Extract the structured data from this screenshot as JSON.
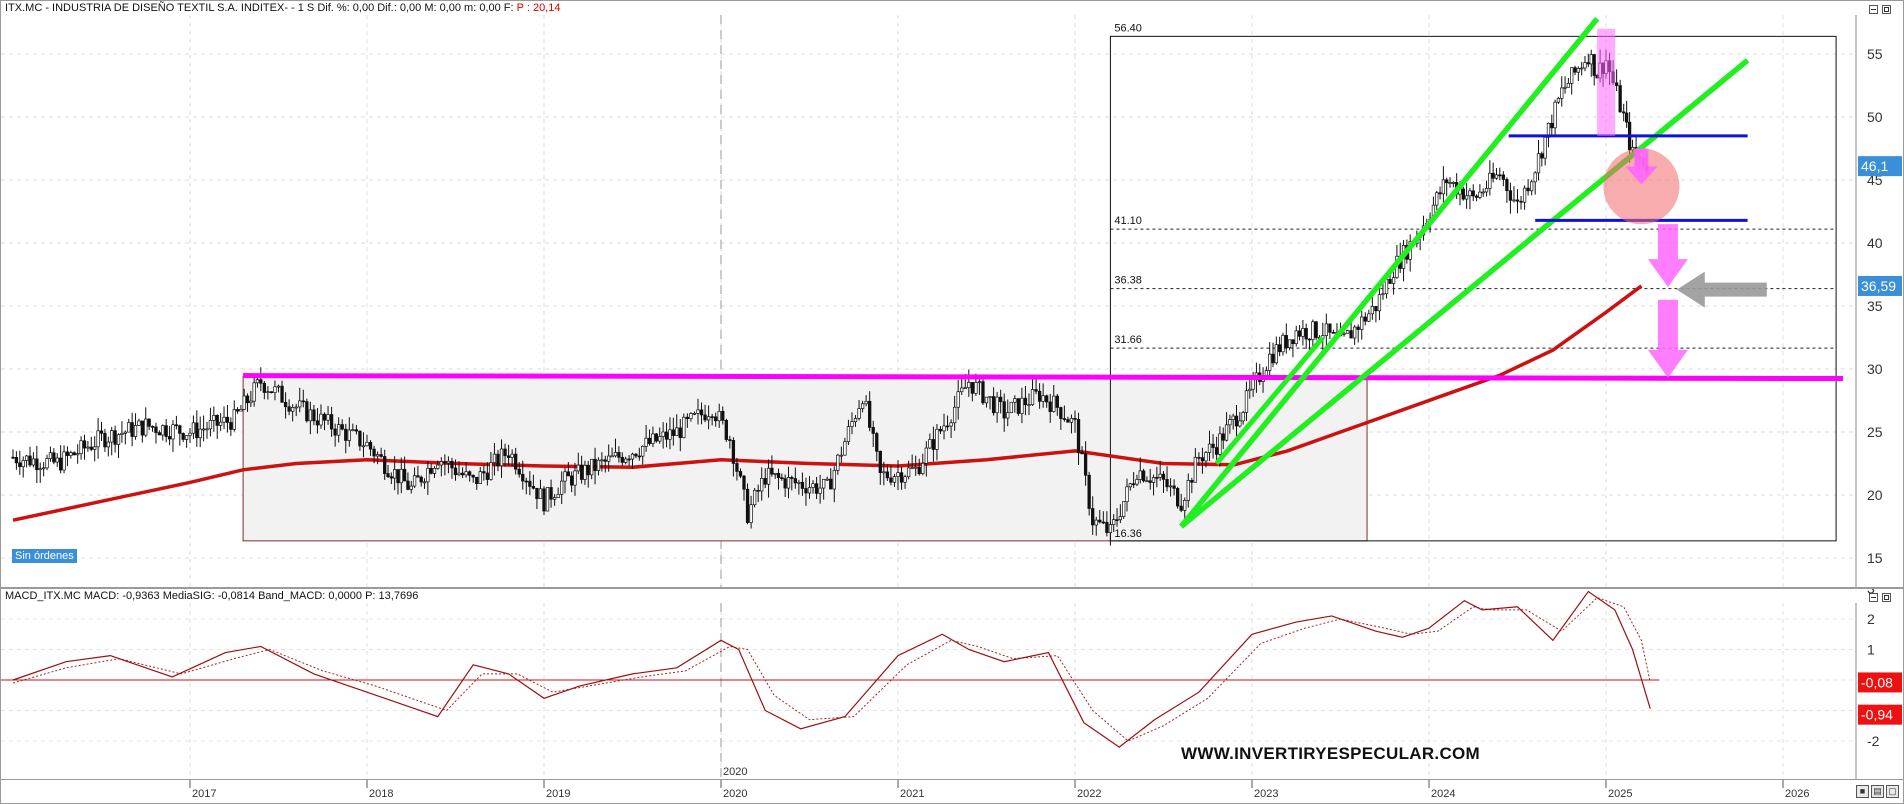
{
  "price_pane": {
    "header": {
      "main": "ITX.MC - INDUSTRIA DE DISEÑO TEXTIL S.A. INDITEX-  -  1 S  Dif. %: 0,00  Dif.: 0,00  M: 0,00  m: 0,00  F:",
      "value": "P : 20,14"
    },
    "badge": "Sin órdenes",
    "y_axis_ticks": [
      "15",
      "20",
      "25",
      "30",
      "35",
      "40",
      "45",
      "50",
      "55"
    ],
    "fib_labels": [
      "56.40",
      "41.10",
      "36.38",
      "31.66",
      "16.36"
    ],
    "price_tag_last": "46,1",
    "price_tag_ma": "36,59"
  },
  "macd_pane": {
    "header": "MACD_ITX.MC  MACD: -0,9363  MediaSIG: -0,0814  Band_MACD: 0,0000  P: 13,7696",
    "y_axis_ticks": [
      "3",
      "2",
      "1",
      "0",
      "-1",
      "-2"
    ],
    "tag_signal": "-0,08",
    "tag_macd": "-0,94",
    "watermark": "WWW.INVERTIRYESPECULAR.COM"
  },
  "x_axis": {
    "year_labels": [
      "2017",
      "2018",
      "2019",
      "2020",
      "2021",
      "2022",
      "2023",
      "2024",
      "2025",
      "2026"
    ],
    "cursor_label": "2020"
  },
  "colors": {
    "candles": "#111111",
    "ma": "#cc1111",
    "resistance": "#ff00ff",
    "channel": "#22ee22",
    "support_lines": "#1111dd",
    "arrows": "#ff66ff",
    "gray_arrow": "#999999",
    "tag_blue": "#3b8fd9",
    "tag_red": "#ee1111"
  },
  "chart_data": [
    {
      "type": "line",
      "title": "ITX.MC - INDUSTRIA DE DISEÑO TEXTIL S.A. INDITEX",
      "x_unit": "year",
      "xlim": [
        2016.0,
        2026.6
      ],
      "ylim": [
        14,
        58
      ],
      "series": [
        {
          "style": "candlestick-weekly",
          "x": [
            2016.0,
            2016.25,
            2016.5,
            2016.75,
            2017.0,
            2017.25,
            2017.4,
            2017.6,
            2017.8,
            2018.0,
            2018.1,
            2018.25,
            2018.4,
            2018.6,
            2018.8,
            2019.0,
            2019.1,
            2019.25,
            2019.5,
            2019.75,
            2019.95,
            2020.05,
            2020.15,
            2020.25,
            2020.4,
            2020.6,
            2020.8,
            2020.9,
            2021.1,
            2021.3,
            2021.4,
            2021.6,
            2021.8,
            2021.9,
            2022.0,
            2022.1,
            2022.2,
            2022.35,
            2022.5,
            2022.6,
            2022.7,
            2022.8,
            2022.95,
            2023.1,
            2023.25,
            2023.4,
            2023.5,
            2023.7,
            2023.8,
            2023.95,
            2024.1,
            2024.25,
            2024.4,
            2024.5,
            2024.6,
            2024.75,
            2024.9,
            2024.95,
            2025.0,
            2025.1,
            2025.15,
            2025.25
          ],
          "y": [
            23,
            22.5,
            24.5,
            25.5,
            25,
            26,
            29,
            27,
            25.5,
            24,
            22.5,
            20.5,
            23,
            21,
            23.5,
            19.5,
            21,
            22,
            23.5,
            25,
            27,
            24.5,
            18.5,
            21.5,
            21,
            20.5,
            28,
            21.5,
            22,
            26.5,
            29,
            26.5,
            28,
            27,
            25.5,
            18,
            17,
            22,
            21,
            19.5,
            23,
            24,
            27,
            31,
            33,
            33,
            32,
            35,
            38,
            41,
            45,
            43.5,
            45.5,
            43,
            46,
            52,
            55,
            53.5,
            54.5,
            50,
            47,
            46.1
          ]
        },
        {
          "style": "moving-average",
          "x": [
            2016.0,
            2016.5,
            2017.0,
            2017.3,
            2017.6,
            2018.0,
            2018.5,
            2019.0,
            2019.5,
            2020.0,
            2020.5,
            2021.0,
            2021.5,
            2022.0,
            2022.5,
            2022.9,
            2023.2,
            2023.5,
            2023.8,
            2024.1,
            2024.4,
            2024.7,
            2025.0,
            2025.2
          ],
          "y": [
            18,
            19.5,
            21,
            22,
            22.5,
            22.8,
            22.5,
            22.3,
            22.2,
            22.8,
            22.5,
            22.3,
            22.8,
            23.5,
            22.5,
            22.4,
            23.5,
            25,
            26.5,
            28,
            29.5,
            31.5,
            34.5,
            36.59
          ]
        }
      ],
      "annotations": {
        "horizontal_resistance": 29.4,
        "fib_levels": [
          56.4,
          41.1,
          36.38,
          31.66,
          16.36
        ],
        "support_lines": [
          48.5,
          41.8
        ]
      }
    },
    {
      "type": "line",
      "title": "MACD_ITX.MC",
      "x_unit": "year",
      "xlim": [
        2016.0,
        2026.6
      ],
      "ylim": [
        -2.6,
        3.2
      ],
      "series": [
        {
          "style": "macd",
          "x": [
            2016.0,
            2016.3,
            2016.55,
            2016.9,
            2017.2,
            2017.4,
            2017.7,
            2018.0,
            2018.25,
            2018.4,
            2018.6,
            2018.8,
            2019.0,
            2019.2,
            2019.5,
            2019.75,
            2020.0,
            2020.1,
            2020.25,
            2020.45,
            2020.7,
            2021.0,
            2021.25,
            2021.4,
            2021.6,
            2021.85,
            2022.05,
            2022.25,
            2022.45,
            2022.7,
            2023.0,
            2023.25,
            2023.45,
            2023.7,
            2023.85,
            2024.0,
            2024.2,
            2024.3,
            2024.5,
            2024.7,
            2024.9,
            2025.05,
            2025.15,
            2025.25
          ],
          "y": [
            0.0,
            0.6,
            0.8,
            0.1,
            0.9,
            1.1,
            0.2,
            -0.4,
            -0.9,
            -1.2,
            0.5,
            0.2,
            -0.6,
            -0.2,
            0.2,
            0.4,
            1.3,
            1.0,
            -1.0,
            -1.6,
            -1.2,
            0.8,
            1.5,
            1.0,
            0.6,
            0.9,
            -1.4,
            -2.2,
            -1.3,
            -0.4,
            1.5,
            1.9,
            2.1,
            1.6,
            1.4,
            1.7,
            2.6,
            2.3,
            2.4,
            1.3,
            2.9,
            2.3,
            1.0,
            -0.94
          ]
        },
        {
          "style": "signal",
          "x": [
            2016.0,
            2016.3,
            2016.6,
            2016.95,
            2017.25,
            2017.45,
            2017.75,
            2018.05,
            2018.3,
            2018.45,
            2018.65,
            2018.85,
            2019.05,
            2019.25,
            2019.55,
            2019.8,
            2020.05,
            2020.15,
            2020.3,
            2020.5,
            2020.75,
            2021.05,
            2021.3,
            2021.45,
            2021.65,
            2021.9,
            2022.1,
            2022.3,
            2022.5,
            2022.75,
            2023.05,
            2023.3,
            2023.5,
            2023.75,
            2023.9,
            2024.05,
            2024.25,
            2024.35,
            2024.55,
            2024.75,
            2024.95,
            2025.1,
            2025.2,
            2025.25
          ],
          "y": [
            -0.1,
            0.4,
            0.7,
            0.2,
            0.7,
            1.0,
            0.3,
            -0.2,
            -0.7,
            -1.0,
            0.2,
            0.2,
            -0.4,
            -0.2,
            0.1,
            0.3,
            1.1,
            1.0,
            -0.5,
            -1.3,
            -1.2,
            0.5,
            1.3,
            1.1,
            0.7,
            0.8,
            -1.0,
            -2.0,
            -1.5,
            -0.6,
            1.2,
            1.7,
            2.0,
            1.7,
            1.5,
            1.6,
            2.4,
            2.3,
            2.3,
            1.6,
            2.7,
            2.4,
            1.3,
            -0.08
          ]
        }
      ],
      "annotations": {
        "zero_band": 0.0
      }
    }
  ]
}
